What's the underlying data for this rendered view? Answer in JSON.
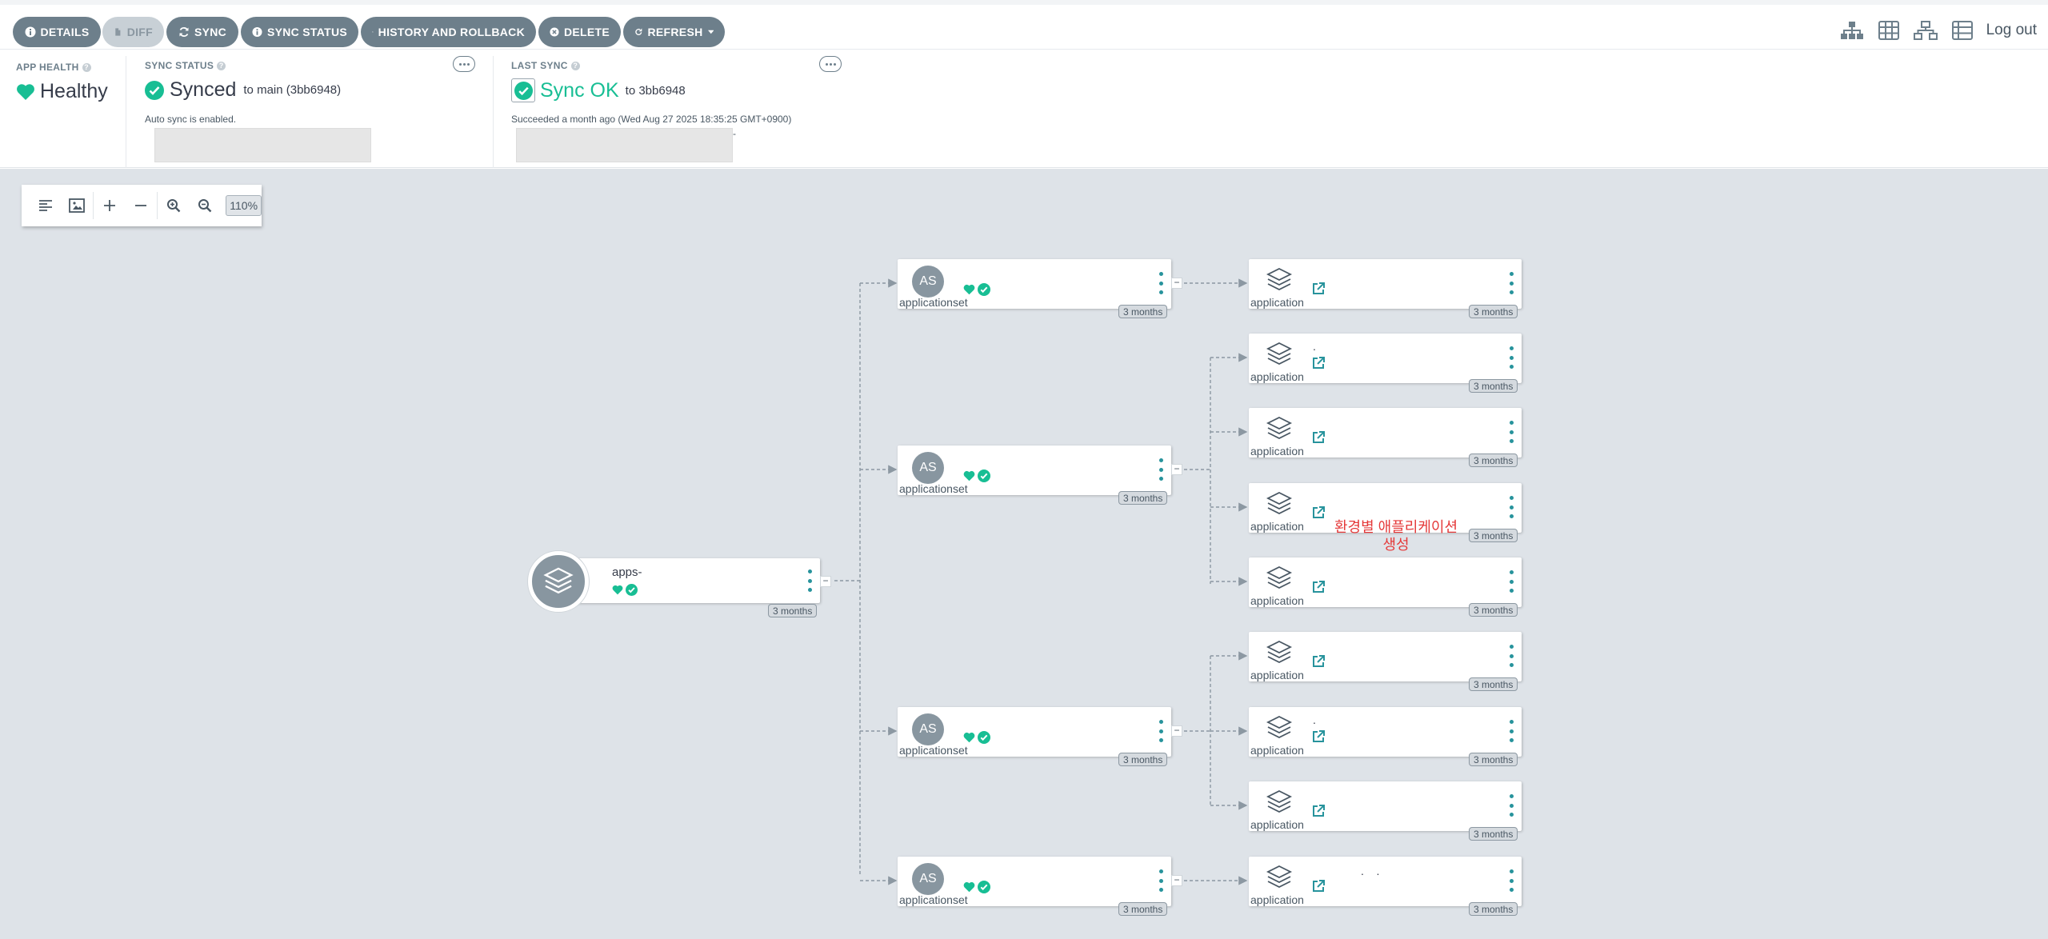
{
  "toolbar": {
    "buttons": [
      {
        "label": "DETAILS",
        "icon": "info-icon"
      },
      {
        "label": "DIFF",
        "icon": "file-icon"
      },
      {
        "label": "SYNC",
        "icon": "sync-icon"
      },
      {
        "label": "SYNC STATUS",
        "icon": "info-icon"
      },
      {
        "label": "HISTORY AND ROLLBACK",
        "icon": "history-icon"
      },
      {
        "label": "DELETE",
        "icon": "times-circle-icon"
      },
      {
        "label": "REFRESH",
        "icon": "refresh-icon"
      }
    ],
    "logout": "Log out"
  },
  "status": {
    "app_health": {
      "label": "APP HEALTH",
      "value": "Healthy"
    },
    "sync_status": {
      "label": "SYNC STATUS",
      "value": "Synced",
      "target": "to main (3bb6948)",
      "note": "Auto sync is enabled."
    },
    "last_sync": {
      "label": "LAST SYNC",
      "value": "Sync OK",
      "target": "to 3bb6948",
      "note": "Succeeded a month ago (Wed Aug 27 2025 18:35:25 GMT+0900)",
      "dash": "-"
    }
  },
  "zoom": {
    "level": "110%"
  },
  "graph": {
    "root": {
      "name": "apps-",
      "age": "3 months"
    },
    "applicationsets": [
      {
        "initials": "AS",
        "kind": "applicationset",
        "age": "3 months"
      },
      {
        "initials": "AS",
        "kind": "applicationset",
        "age": "3 months"
      },
      {
        "initials": "AS",
        "kind": "applicationset",
        "age": "3 months"
      },
      {
        "initials": "AS",
        "kind": "applicationset",
        "age": "3 months"
      }
    ],
    "applications": [
      {
        "kind": "application",
        "age": "3 months",
        "name": ""
      },
      {
        "kind": "application",
        "age": "3 months",
        "name": "."
      },
      {
        "kind": "application",
        "age": "3 months",
        "name": ""
      },
      {
        "kind": "application",
        "age": "3 months",
        "name": ""
      },
      {
        "kind": "application",
        "age": "3 months",
        "name": ""
      },
      {
        "kind": "application",
        "age": "3 months",
        "name": ""
      },
      {
        "kind": "application",
        "age": "3 months",
        "name": "."
      },
      {
        "kind": "application",
        "age": "3 months",
        "name": ""
      },
      {
        "kind": "application",
        "age": "3 months",
        "name": ".    ."
      }
    ],
    "annotation": "환경별 애플리케이션 생성"
  },
  "colors": {
    "healthy": "#18be94",
    "button": "#6d7f8b",
    "canvas": "#dee3e8",
    "annotation": "#e53a3a"
  }
}
